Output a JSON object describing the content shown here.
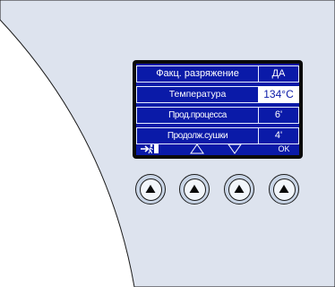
{
  "display": {
    "rows": [
      {
        "label": "Факц. разряжение",
        "value": "ДА",
        "selected": false
      },
      {
        "label": "Температура",
        "value": "134°C",
        "selected": true
      },
      {
        "label": "Прод.процесса",
        "value": "6'",
        "selected": false
      },
      {
        "label": "Продолж.сушки",
        "value": "4'",
        "selected": false
      }
    ],
    "softkeys": {
      "exit_icon": "exit-arrow-icon",
      "up_icon": "triangle-up-outline-icon",
      "down_icon": "triangle-down-outline-icon",
      "ok_label": "OK"
    }
  },
  "hardware_buttons": {
    "icon": "triangle-up-filled-icon",
    "count": 4
  },
  "colors": {
    "lcd_background": "#0a1aa8",
    "lcd_frame": "#0a0a0a",
    "panel": "#dde3ee",
    "button_ring": "#c9d5e6"
  }
}
